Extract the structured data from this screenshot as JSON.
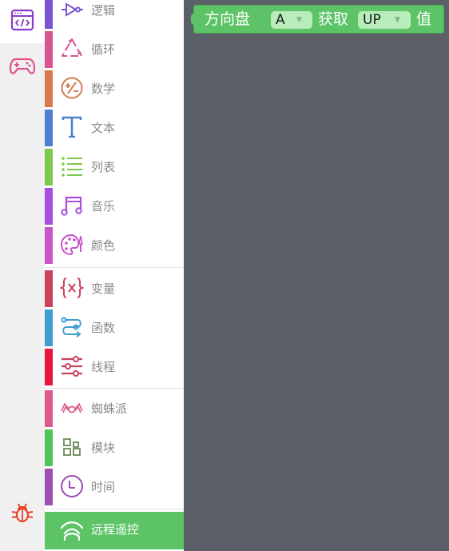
{
  "rail": {
    "buttons": [
      {
        "name": "code-editor",
        "icon": "code-window-icon"
      },
      {
        "name": "gamepad",
        "icon": "gamepad-icon"
      },
      {
        "name": "debug",
        "icon": "bug-icon"
      }
    ]
  },
  "toolbox": {
    "categories": [
      {
        "label": "逻辑",
        "color": "#7b55d1",
        "icon": "logic-gate-icon"
      },
      {
        "label": "循环",
        "color": "#d8568f",
        "icon": "loop-icon"
      },
      {
        "label": "数学",
        "color": "#d77a4f",
        "icon": "math-icon"
      },
      {
        "label": "文本",
        "color": "#4f7fd1",
        "icon": "text-icon"
      },
      {
        "label": "列表",
        "color": "#7dc84e",
        "icon": "list-icon"
      },
      {
        "label": "音乐",
        "color": "#a64fe0",
        "icon": "music-note-icon"
      },
      {
        "label": "颜色",
        "color": "#c855c8",
        "icon": "palette-icon"
      },
      {
        "label": "变量",
        "color": "#c9425a",
        "icon": "variable-icon"
      },
      {
        "label": "函数",
        "color": "#3e9ed1",
        "icon": "function-icon"
      },
      {
        "label": "线程",
        "color": "#e8163f",
        "icon": "sliders-icon"
      },
      {
        "label": "蜘蛛派",
        "color": "#de5a8e",
        "icon": "spider-icon"
      },
      {
        "label": "模块",
        "color": "#52c55a",
        "icon": "module-grid-icon"
      },
      {
        "label": "时间",
        "color": "#9d4eb3",
        "icon": "clock-icon"
      },
      {
        "label": "远程遥控",
        "color": "#5cc466",
        "icon": "remote-signal-icon",
        "selected": true
      }
    ]
  },
  "workspace": {
    "block": {
      "prefix": "方向盘",
      "joystick_value": "A",
      "middle": "获取",
      "button_value": "UP",
      "suffix": "值",
      "color": "#5cc466"
    }
  }
}
